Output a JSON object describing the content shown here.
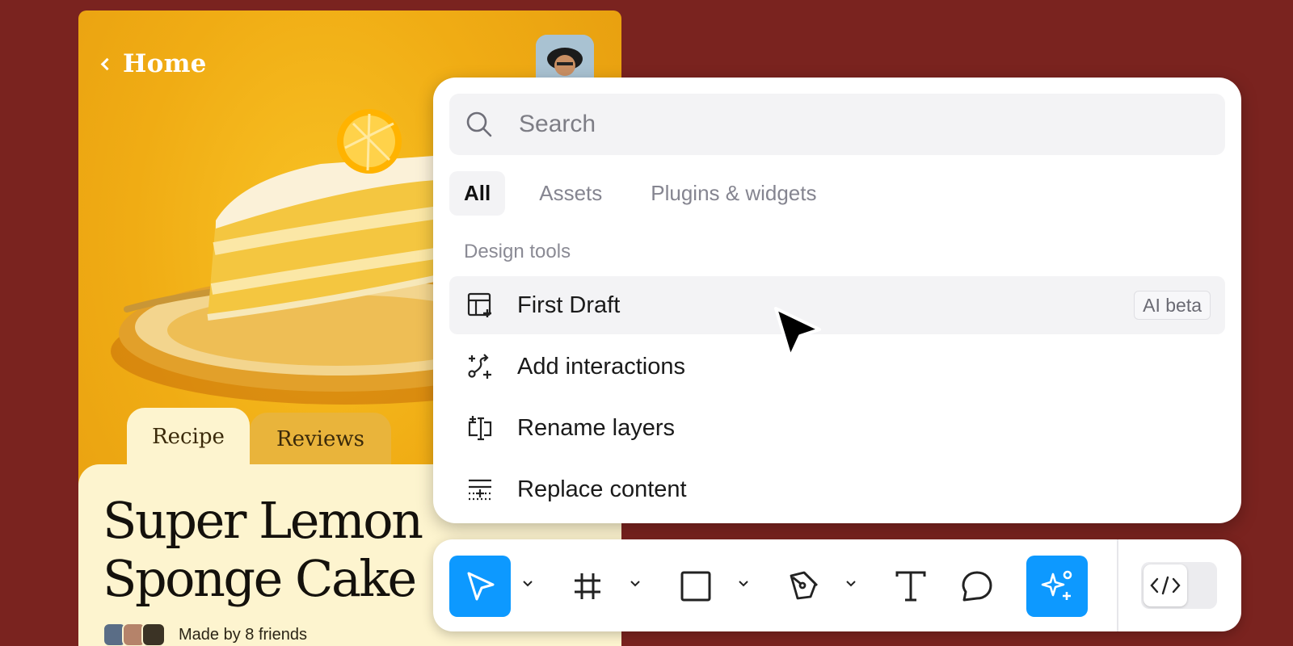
{
  "recipe_app": {
    "back_label": "Home",
    "tabs": [
      {
        "label": "Recipe",
        "active": true
      },
      {
        "label": "Reviews",
        "active": false
      }
    ],
    "title": "Super Lemon Sponge Cake",
    "made_by": "Made by 8 friends"
  },
  "search_panel": {
    "search": {
      "placeholder": "Search",
      "value": ""
    },
    "filter_tabs": [
      {
        "label": "All",
        "active": true
      },
      {
        "label": "Assets",
        "active": false
      },
      {
        "label": "Plugins & widgets",
        "active": false
      }
    ],
    "section_title": "Design tools",
    "items": [
      {
        "label": "First Draft",
        "icon": "layout-sparkle-icon",
        "badge": "AI beta",
        "highlighted": true
      },
      {
        "label": "Add interactions",
        "icon": "interaction-sparkle-icon"
      },
      {
        "label": "Rename layers",
        "icon": "rename-sparkle-icon"
      },
      {
        "label": "Replace content",
        "icon": "replace-content-icon"
      }
    ]
  },
  "toolbar": {
    "tools": [
      {
        "name": "move",
        "icon": "move-cursor-icon",
        "active": true,
        "has_menu": true
      },
      {
        "name": "frame",
        "icon": "frame-hash-icon",
        "active": false,
        "has_menu": true
      },
      {
        "name": "rectangle",
        "icon": "rectangle-icon",
        "active": false,
        "has_menu": true
      },
      {
        "name": "pen",
        "icon": "pen-icon",
        "active": false,
        "has_menu": true
      },
      {
        "name": "text",
        "icon": "text-icon",
        "active": false,
        "has_menu": false
      },
      {
        "name": "comment",
        "icon": "comment-icon",
        "active": false,
        "has_menu": false
      },
      {
        "name": "actions",
        "icon": "ai-sparkle-icon",
        "active": true,
        "has_menu": false
      }
    ],
    "dev_mode_icon": "code-icon"
  },
  "colors": {
    "background": "#7a231f",
    "accent_blue": "#0d99ff",
    "card_yellow": "#f0ac14",
    "card_cream": "#fdf4cf"
  }
}
